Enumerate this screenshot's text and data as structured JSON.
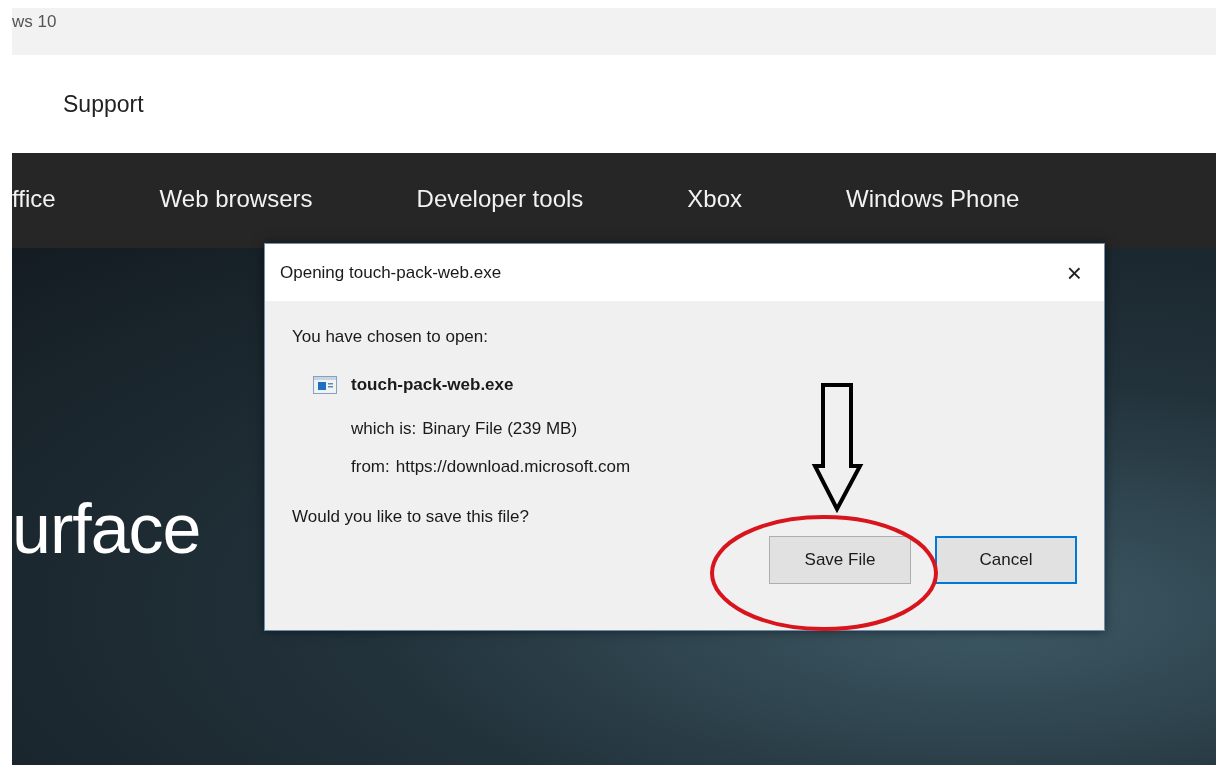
{
  "header": {
    "title": "ws 10",
    "link": "Support"
  },
  "nav": {
    "items": [
      {
        "label": "ffice"
      },
      {
        "label": "Web browsers"
      },
      {
        "label": "Developer tools"
      },
      {
        "label": "Xbox"
      },
      {
        "label": "Windows Phone"
      }
    ]
  },
  "hero": {
    "headline": "urface"
  },
  "dialog": {
    "title": "Opening touch-pack-web.exe",
    "close": "×",
    "intro": "You have chosen to open:",
    "file_name": "touch-pack-web.exe",
    "details": [
      {
        "label": "which is:",
        "value": "Binary File (239 MB)"
      },
      {
        "label": "from:",
        "value": "https://download.microsoft.com"
      }
    ],
    "question": "Would you like to save this file?",
    "buttons": [
      {
        "label": "Save File",
        "focused": false
      },
      {
        "label": "Cancel",
        "focused": true
      }
    ]
  }
}
